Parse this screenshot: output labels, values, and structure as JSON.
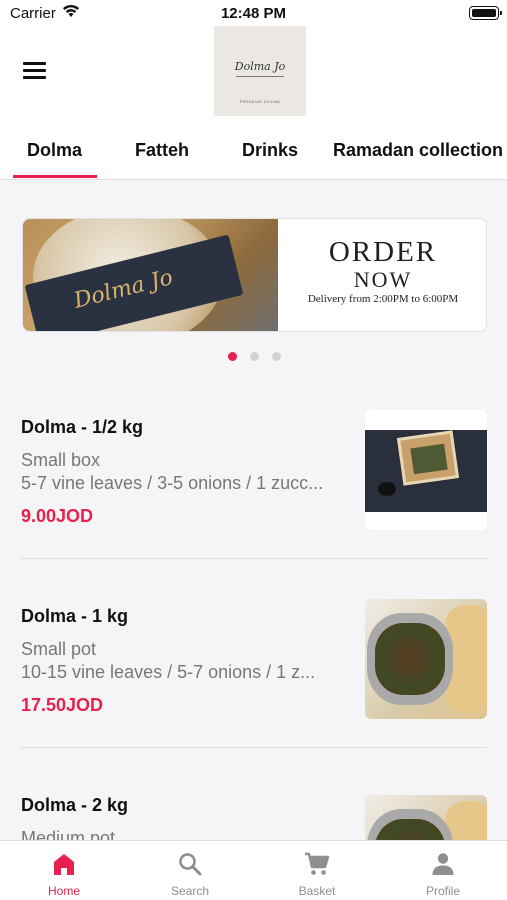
{
  "status_bar": {
    "carrier": "Carrier",
    "time": "12:48 PM"
  },
  "header": {
    "logo": {
      "script": "Dolma Jo",
      "subtitle": "PREMIUM DOLMA"
    }
  },
  "tabs": [
    {
      "label": "Dolma",
      "active": true
    },
    {
      "label": "Fatteh",
      "active": false
    },
    {
      "label": "Drinks",
      "active": false
    },
    {
      "label": "Ramadan collection",
      "active": false
    }
  ],
  "banner": {
    "title_line1": "ORDER",
    "title_line2": "NOW",
    "subtitle": "Delivery from 2:00PM to 6:00PM",
    "box_script": "Dolma Jo"
  },
  "carousel": {
    "pages": 3,
    "active_index": 0
  },
  "products": [
    {
      "name": "Dolma - 1/2 kg",
      "size": "Small box",
      "description": "5-7 vine leaves / 3-5 onions / 1 zucc...",
      "price": "9.00JOD"
    },
    {
      "name": "Dolma - 1 kg",
      "size": "Small pot",
      "description": "10-15 vine leaves / 5-7 onions / 1 z...",
      "price": "17.50JOD"
    },
    {
      "name": "Dolma - 2 kg",
      "size": "Medium pot",
      "description": "",
      "price": ""
    }
  ],
  "tab_bar": [
    {
      "label": "Home",
      "icon": "home-icon",
      "active": true
    },
    {
      "label": "Search",
      "icon": "search-icon",
      "active": false
    },
    {
      "label": "Basket",
      "icon": "cart-icon",
      "active": false
    },
    {
      "label": "Profile",
      "icon": "person-icon",
      "active": false
    }
  ],
  "colors": {
    "accent": "#e8204f",
    "muted_text": "#777777",
    "background": "#f5f5f7"
  }
}
